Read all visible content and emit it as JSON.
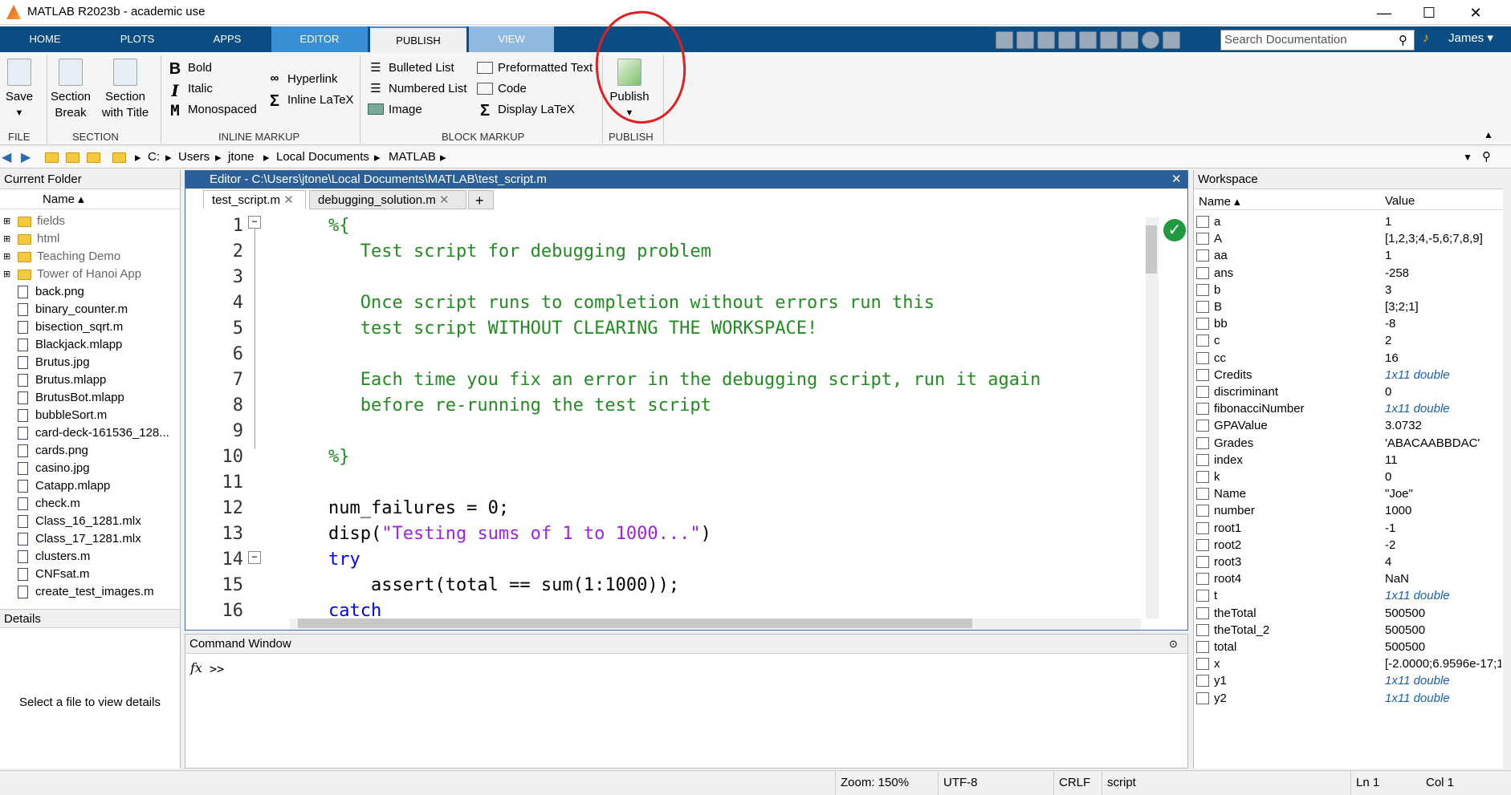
{
  "window": {
    "title": "MATLAB R2023b - academic use",
    "minimize": "—",
    "maximize": "☐",
    "close": "✕"
  },
  "tabs": [
    "HOME",
    "PLOTS",
    "APPS",
    "EDITOR",
    "PUBLISH",
    "VIEW"
  ],
  "search": {
    "placeholder": "Search Documentation"
  },
  "user": {
    "name": "James ▾"
  },
  "ribbon": {
    "save": "Save",
    "section_break": [
      "Section",
      "Break"
    ],
    "section_title": [
      "Section",
      "with Title"
    ],
    "bold": "Bold",
    "italic": "Italic",
    "monospaced": "Monospaced",
    "hyperlink": "Hyperlink",
    "inline_latex": "Inline LaTeX",
    "bulleted_list": "Bulleted List",
    "numbered_list": "Numbered List",
    "image": "Image",
    "preformatted_text": "Preformatted Text",
    "code": "Code",
    "display_latex": "Display LaTeX",
    "publish": "Publish",
    "groups": {
      "file": "FILE",
      "section": "SECTION",
      "inline_markup": "INLINE MARKUP",
      "block_markup": "BLOCK MARKUP",
      "publish": "PUBLISH"
    }
  },
  "address": [
    "C:",
    "Users",
    "jtone",
    "Local Documents",
    "MATLAB"
  ],
  "current_folder": {
    "title": "Current Folder",
    "column": "Name ▴",
    "folders": [
      "fields",
      "html",
      "Teaching Demo",
      "Tower of Hanoi App"
    ],
    "files": [
      "back.png",
      "binary_counter.m",
      "bisection_sqrt.m",
      "Blackjack.mlapp",
      "Brutus.jpg",
      "Brutus.mlapp",
      "BrutusBot.mlapp",
      "bubbleSort.m",
      "card-deck-161536_128...",
      "cards.png",
      "casino.jpg",
      "Catapp.mlapp",
      "check.m",
      "Class_16_1281.mlx",
      "Class_17_1281.mlx",
      "clusters.m",
      "CNFsat.m",
      "create_test_images.m"
    ],
    "details_title": "Details",
    "details_text": "Select a file to view details"
  },
  "editor": {
    "title": "Editor - C:\\Users\\jtone\\Local Documents\\MATLAB\\test_script.m",
    "tabs": [
      "test_script.m",
      "debugging_solution.m"
    ],
    "lines": [
      {
        "n": "1",
        "t": "%{",
        "c": "cm"
      },
      {
        "n": "2",
        "t": "   Test script for debugging problem",
        "c": "cm"
      },
      {
        "n": "3",
        "t": "",
        "c": "cm"
      },
      {
        "n": "4",
        "t": "   Once script runs to completion without errors run this",
        "c": "cm"
      },
      {
        "n": "5",
        "t": "   test script WITHOUT CLEARING THE WORKSPACE!",
        "c": "cm"
      },
      {
        "n": "6",
        "t": "",
        "c": "cm"
      },
      {
        "n": "7",
        "t": "   Each time you fix an error in the debugging script, run it again",
        "c": "cm"
      },
      {
        "n": "8",
        "t": "   before re-running the test script",
        "c": "cm"
      },
      {
        "n": "9",
        "t": "",
        "c": "cm"
      },
      {
        "n": "10",
        "t": "%}",
        "c": "cm"
      },
      {
        "n": "11",
        "t": "",
        "c": ""
      },
      {
        "n": "12",
        "t": "num_failures = 0;",
        "c": ""
      },
      {
        "n": "13",
        "t": "disp(",
        "t2": "\"Testing sums of 1 to 1000...\"",
        "t3": ")",
        "c": ""
      },
      {
        "n": "14",
        "t": "try",
        "c": "kw"
      },
      {
        "n": "15",
        "t": "    assert(total == sum(1:1000));",
        "c": ""
      },
      {
        "n": "16",
        "t": "catch",
        "c": "kw"
      }
    ]
  },
  "command_window": {
    "title": "Command Window",
    "prompt": ">>",
    "fx": "fx"
  },
  "workspace": {
    "title": "Workspace",
    "col_name": "Name ▴",
    "col_value": "Value",
    "vars": [
      {
        "n": "a",
        "v": "1"
      },
      {
        "n": "A",
        "v": "[1,2,3;4,-5,6;7,8,9]"
      },
      {
        "n": "aa",
        "v": "1"
      },
      {
        "n": "ans",
        "v": "-258"
      },
      {
        "n": "b",
        "v": "3"
      },
      {
        "n": "B",
        "v": "[3;2;1]"
      },
      {
        "n": "bb",
        "v": "-8"
      },
      {
        "n": "c",
        "v": "2"
      },
      {
        "n": "cc",
        "v": "16"
      },
      {
        "n": "Credits",
        "v": "1x11 double",
        "it": true
      },
      {
        "n": "discriminant",
        "v": "0"
      },
      {
        "n": "fibonacciNumber",
        "v": "1x11 double",
        "it": true
      },
      {
        "n": "GPAValue",
        "v": "3.0732"
      },
      {
        "n": "Grades",
        "v": "'ABACAABBDAC'"
      },
      {
        "n": "index",
        "v": "11"
      },
      {
        "n": "k",
        "v": "0"
      },
      {
        "n": "Name",
        "v": "\"Joe\""
      },
      {
        "n": "number",
        "v": "1000"
      },
      {
        "n": "root1",
        "v": "-1"
      },
      {
        "n": "root2",
        "v": "-2"
      },
      {
        "n": "root3",
        "v": "4"
      },
      {
        "n": "root4",
        "v": "NaN"
      },
      {
        "n": "t",
        "v": "1x11 double",
        "it": true
      },
      {
        "n": "theTotal",
        "v": "500500"
      },
      {
        "n": "theTotal_2",
        "v": "500500"
      },
      {
        "n": "total",
        "v": "500500"
      },
      {
        "n": "x",
        "v": "[-2.0000;6.9596e-17;1..."
      },
      {
        "n": "y1",
        "v": "1x11 double",
        "it": true
      },
      {
        "n": "y2",
        "v": "1x11 double",
        "it": true
      }
    ]
  },
  "status": {
    "zoom": "Zoom: 150%",
    "encoding": "UTF-8",
    "eol": "CRLF",
    "type": "script",
    "ln": "Ln  1",
    "col": "Col  1"
  }
}
